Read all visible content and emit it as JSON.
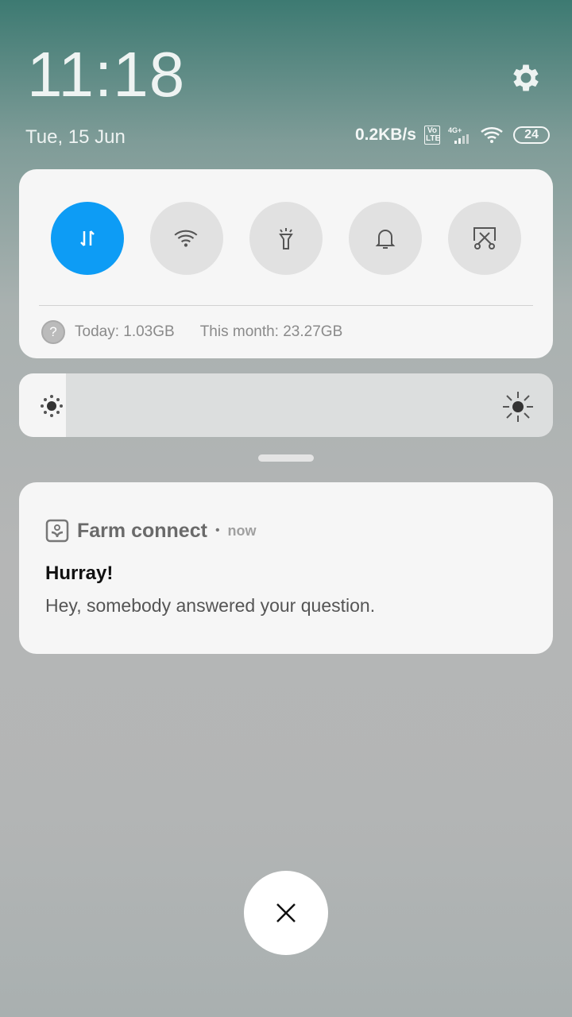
{
  "status": {
    "time": "11:18",
    "date": "Tue, 15 Jun",
    "net_speed": "0.2KB/s",
    "volte": "Vo LTE",
    "network": "4G+",
    "battery": "24"
  },
  "quick_settings": {
    "toggles": [
      {
        "name": "mobile-data",
        "active": true
      },
      {
        "name": "wifi",
        "active": false
      },
      {
        "name": "flashlight",
        "active": false
      },
      {
        "name": "sound",
        "active": false
      },
      {
        "name": "screenshot",
        "active": false
      }
    ],
    "usage_today": "Today: 1.03GB",
    "usage_month": "This month: 23.27GB",
    "help_glyph": "?"
  },
  "brightness": {
    "level": 0.05
  },
  "notification": {
    "app": "Farm connect",
    "separator": "•",
    "time": "now",
    "title": "Hurray!",
    "body": "Hey, somebody answered your question."
  },
  "colors": {
    "accent": "#0d9cf5"
  }
}
